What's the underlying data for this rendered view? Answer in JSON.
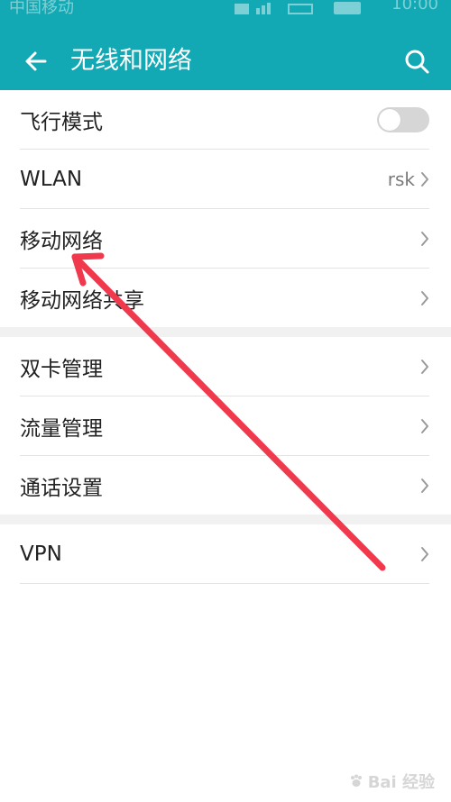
{
  "status": {
    "carrier": "中国移动",
    "time": "10:00"
  },
  "appbar": {
    "title": "无线和网络",
    "back_icon": "arrow-left-icon",
    "search_icon": "search-icon"
  },
  "sections": [
    {
      "items": [
        {
          "label": "飞行模式",
          "control": "toggle",
          "toggle_on": false
        },
        {
          "label": "WLAN",
          "value": "rsk",
          "control": "chevron"
        },
        {
          "label": "移动网络",
          "control": "chevron"
        },
        {
          "label": "移动网络共享",
          "control": "chevron"
        }
      ]
    },
    {
      "items": [
        {
          "label": "双卡管理",
          "control": "chevron"
        },
        {
          "label": "流量管理",
          "control": "chevron"
        },
        {
          "label": "通话设置",
          "control": "chevron"
        }
      ]
    },
    {
      "items": [
        {
          "label": "VPN",
          "control": "chevron"
        }
      ]
    }
  ],
  "watermark": {
    "text": "Bai 经验"
  },
  "colors": {
    "appbar": "#12a9b4",
    "annotation_arrow": "#f0394d"
  }
}
